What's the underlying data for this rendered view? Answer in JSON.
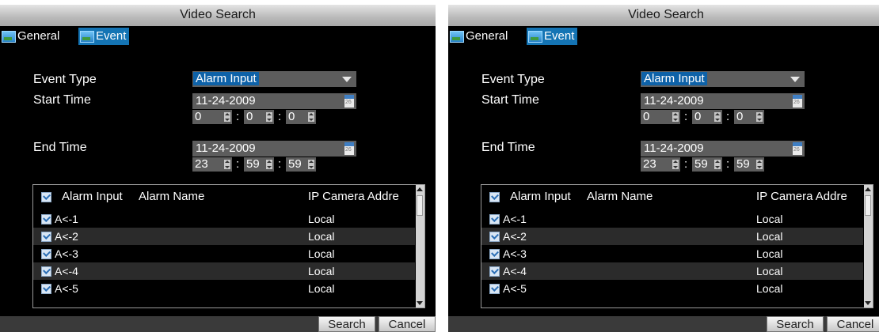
{
  "panels": [
    {
      "title": "Video Search",
      "tabs": [
        {
          "label": "General",
          "icon": "image-icon"
        },
        {
          "label": "Event",
          "icon": "image-icon",
          "active": true
        }
      ],
      "event_type": {
        "label": "Event Type",
        "value": "Alarm Input"
      },
      "start_time": {
        "label": "Start Time",
        "date": "11-24-2009",
        "hour": "0",
        "minute": "0",
        "second": "0"
      },
      "end_time": {
        "label": "End Time",
        "date": "11-24-2009",
        "hour": "23",
        "minute": "59",
        "second": "59"
      },
      "table": {
        "columns": [
          "Alarm Input",
          "Alarm Name",
          "IP Camera Addre"
        ],
        "rows": [
          {
            "input": "A<-1",
            "camera": "Local"
          },
          {
            "input": "A<-2",
            "camera": "Local"
          },
          {
            "input": "A<-3",
            "camera": "Local"
          },
          {
            "input": "A<-4",
            "camera": "Local"
          },
          {
            "input": "A<-5",
            "camera": "Local"
          }
        ]
      },
      "buttons": {
        "search": "Search",
        "cancel": "Cancel"
      }
    },
    {
      "title": "Video Search",
      "tabs": [
        {
          "label": "General",
          "icon": "image-icon"
        },
        {
          "label": "Event",
          "icon": "image-icon",
          "active": true
        }
      ],
      "event_type": {
        "label": "Event Type",
        "value": "Alarm Input"
      },
      "start_time": {
        "label": "Start Time",
        "date": "11-24-2009",
        "hour": "0",
        "minute": "0",
        "second": "0"
      },
      "end_time": {
        "label": "End Time",
        "date": "11-24-2009",
        "hour": "23",
        "minute": "59",
        "second": "59"
      },
      "table": {
        "columns": [
          "Alarm Input",
          "Alarm Name",
          "IP Camera Addre"
        ],
        "rows": [
          {
            "input": "A<-1",
            "camera": "Local"
          },
          {
            "input": "A<-2",
            "camera": "Local"
          },
          {
            "input": "A<-3",
            "camera": "Local"
          },
          {
            "input": "A<-4",
            "camera": "Local"
          },
          {
            "input": "A<-5",
            "camera": "Local"
          }
        ]
      },
      "buttons": {
        "search": "Search",
        "cancel": "Cancel"
      }
    }
  ],
  "colors": {
    "accent": "#1474b4",
    "background": "#000000",
    "field": "#5d5d5d"
  }
}
